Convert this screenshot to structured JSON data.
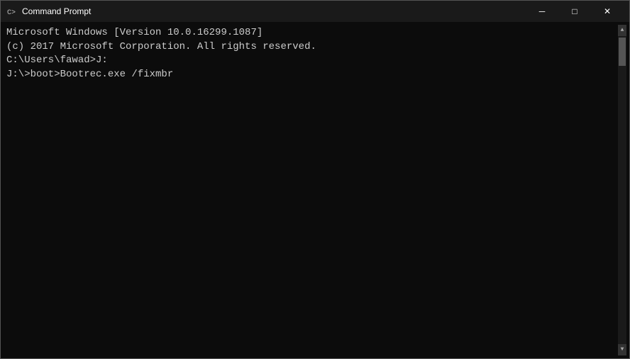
{
  "titleBar": {
    "title": "Command Prompt",
    "icon": "cmd-icon",
    "minimizeLabel": "─",
    "maximizeLabel": "□",
    "closeLabel": "✕"
  },
  "console": {
    "lines": [
      "",
      "Microsoft Windows [Version 10.0.16299.1087]",
      "(c) 2017 Microsoft Corporation. All rights reserved.",
      "",
      "C:\\Users\\fawad>J:",
      "",
      "J:\\>boot>Bootrec.exe /fixmbr"
    ]
  }
}
